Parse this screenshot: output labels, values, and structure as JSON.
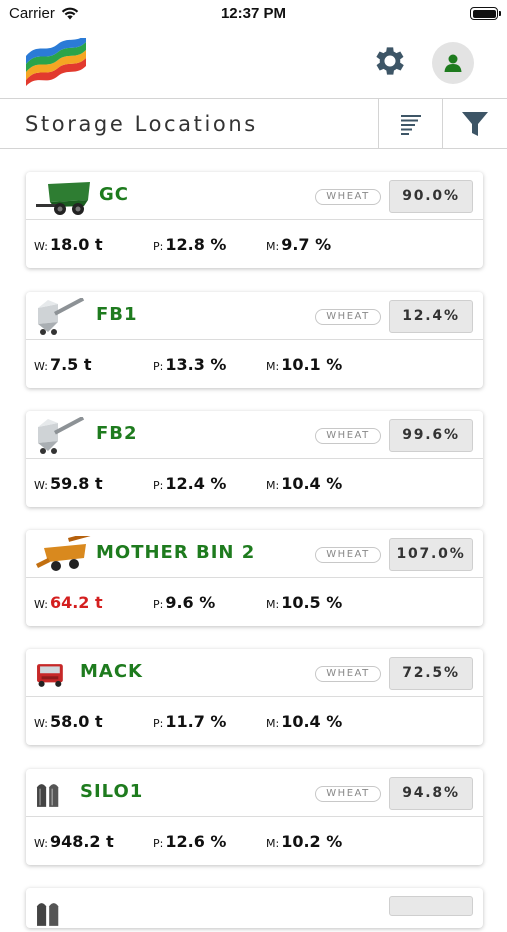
{
  "status": {
    "carrier": "Carrier",
    "time": "12:37 PM"
  },
  "page_title": "Storage Locations",
  "labels": {
    "w": "W:",
    "p": "P:",
    "m": "M:"
  },
  "locations": [
    {
      "name": "GC",
      "crop": "WHEAT",
      "fill": "90.0%",
      "w": "18.0 t",
      "p": "12.8 %",
      "m": "9.7 %",
      "w_alert": false,
      "icon": "grain-cart-icon"
    },
    {
      "name": "FB1",
      "crop": "WHEAT",
      "fill": "12.4%",
      "w": "7.5 t",
      "p": "13.3 %",
      "m": "10.1 %",
      "w_alert": false,
      "icon": "field-bin-icon"
    },
    {
      "name": "FB2",
      "crop": "WHEAT",
      "fill": "99.6%",
      "w": "59.8 t",
      "p": "12.4 %",
      "m": "10.4 %",
      "w_alert": false,
      "icon": "field-bin-icon"
    },
    {
      "name": "MOTHER BIN 2",
      "crop": "WHEAT",
      "fill": "107.0%",
      "w": "64.2 t",
      "p": "9.6 %",
      "m": "10.5 %",
      "w_alert": true,
      "icon": "mother-bin-icon"
    },
    {
      "name": "MACK",
      "crop": "WHEAT",
      "fill": "72.5%",
      "w": "58.0 t",
      "p": "11.7 %",
      "m": "10.4 %",
      "w_alert": false,
      "icon": "truck-icon"
    },
    {
      "name": "SILO1",
      "crop": "WHEAT",
      "fill": "94.8%",
      "w": "948.2 t",
      "p": "12.6 %",
      "m": "10.2 %",
      "w_alert": false,
      "icon": "silo-icon"
    }
  ],
  "colors": {
    "name_green": "#1e7b1e",
    "alert_red": "#d41f1f",
    "icon_gray": "#3d5566",
    "avatar_green": "#1e7b1e"
  }
}
